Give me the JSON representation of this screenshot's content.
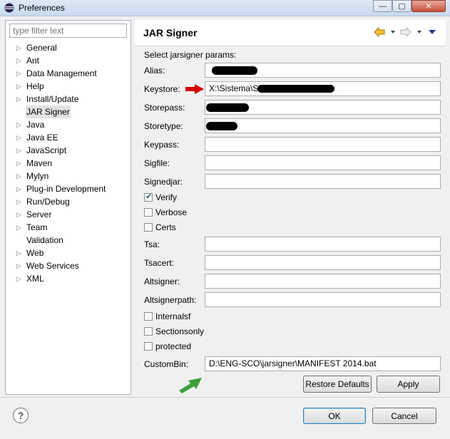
{
  "window": {
    "title": "Preferences",
    "controls": [
      "—",
      "▢",
      "✕"
    ]
  },
  "filter": {
    "placeholder": "type filter text"
  },
  "tree": [
    {
      "label": "General",
      "expandable": true
    },
    {
      "label": "Ant",
      "expandable": true
    },
    {
      "label": "Data Management",
      "expandable": true
    },
    {
      "label": "Help",
      "expandable": true
    },
    {
      "label": "Install/Update",
      "expandable": true
    },
    {
      "label": "JAR Signer",
      "expandable": false,
      "selected": true
    },
    {
      "label": "Java",
      "expandable": true
    },
    {
      "label": "Java EE",
      "expandable": true
    },
    {
      "label": "JavaScript",
      "expandable": true
    },
    {
      "label": "Maven",
      "expandable": true
    },
    {
      "label": "Mylyn",
      "expandable": true
    },
    {
      "label": "Plug-in Development",
      "expandable": true
    },
    {
      "label": "Run/Debug",
      "expandable": true
    },
    {
      "label": "Server",
      "expandable": true
    },
    {
      "label": "Team",
      "expandable": true
    },
    {
      "label": "Validation",
      "expandable": false
    },
    {
      "label": "Web",
      "expandable": true
    },
    {
      "label": "Web Services",
      "expandable": true
    },
    {
      "label": "XML",
      "expandable": true
    }
  ],
  "page": {
    "title": "JAR Signer",
    "section_label": "Select jarsigner params:"
  },
  "fields": {
    "alias": {
      "label": "Alias:",
      "value": ""
    },
    "keystore": {
      "label": "Keystore:",
      "value": "X:\\Sistema\\S"
    },
    "storepass": {
      "label": "Storepass:",
      "value": ""
    },
    "storetype": {
      "label": "Storetype:",
      "value": ""
    },
    "keypass": {
      "label": "Keypass:",
      "value": ""
    },
    "sigfile": {
      "label": "Sigfile:",
      "value": ""
    },
    "signedjar": {
      "label": "Signedjar:",
      "value": ""
    },
    "tsa": {
      "label": "Tsa:",
      "value": ""
    },
    "tsacert": {
      "label": "Tsacert:",
      "value": ""
    },
    "altsigner": {
      "label": "Altsigner:",
      "value": ""
    },
    "altsignerpath": {
      "label": "Altsignerpath:",
      "value": ""
    },
    "custombin": {
      "label": "CustomBin:",
      "value": "D:\\ENG-SCO\\jarsigner\\MANIFEST 2014.bat"
    }
  },
  "checkboxes": {
    "verify": {
      "label": "Verify",
      "checked": true
    },
    "verbose": {
      "label": "Verbose",
      "checked": false
    },
    "certs": {
      "label": "Certs",
      "checked": false
    },
    "internalsf": {
      "label": "Internalsf",
      "checked": false
    },
    "sectionsonly": {
      "label": "Sectionsonly",
      "checked": false
    },
    "protected": {
      "label": "protected",
      "checked": false
    }
  },
  "buttons": {
    "restore_defaults": "Restore Defaults",
    "apply": "Apply",
    "ok": "OK",
    "cancel": "Cancel"
  },
  "icons": {
    "back": "back-arrow-icon",
    "forward": "forward-arrow-icon",
    "menu": "view-menu-icon",
    "help": "?"
  },
  "annotation_colors": {
    "red_arrow": "#d40000",
    "green_arrow": "#3aa03a"
  }
}
